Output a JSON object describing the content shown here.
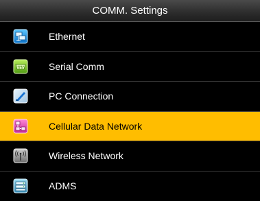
{
  "title": "COMM. Settings",
  "menu": {
    "items": [
      {
        "label": "Ethernet",
        "icon": "ethernet-icon",
        "selected": false
      },
      {
        "label": "Serial Comm",
        "icon": "serial-port-icon",
        "selected": false
      },
      {
        "label": "PC Connection",
        "icon": "pc-connection-icon",
        "selected": false
      },
      {
        "label": "Cellular Data Network",
        "icon": "cellular-network-icon",
        "selected": true
      },
      {
        "label": "Wireless Network",
        "icon": "wireless-antenna-icon",
        "selected": false
      },
      {
        "label": "ADMS",
        "icon": "adms-server-icon",
        "selected": false
      }
    ]
  },
  "colors": {
    "selected_background": "#ffbd00",
    "background": "#000000",
    "text": "#ffffff"
  }
}
